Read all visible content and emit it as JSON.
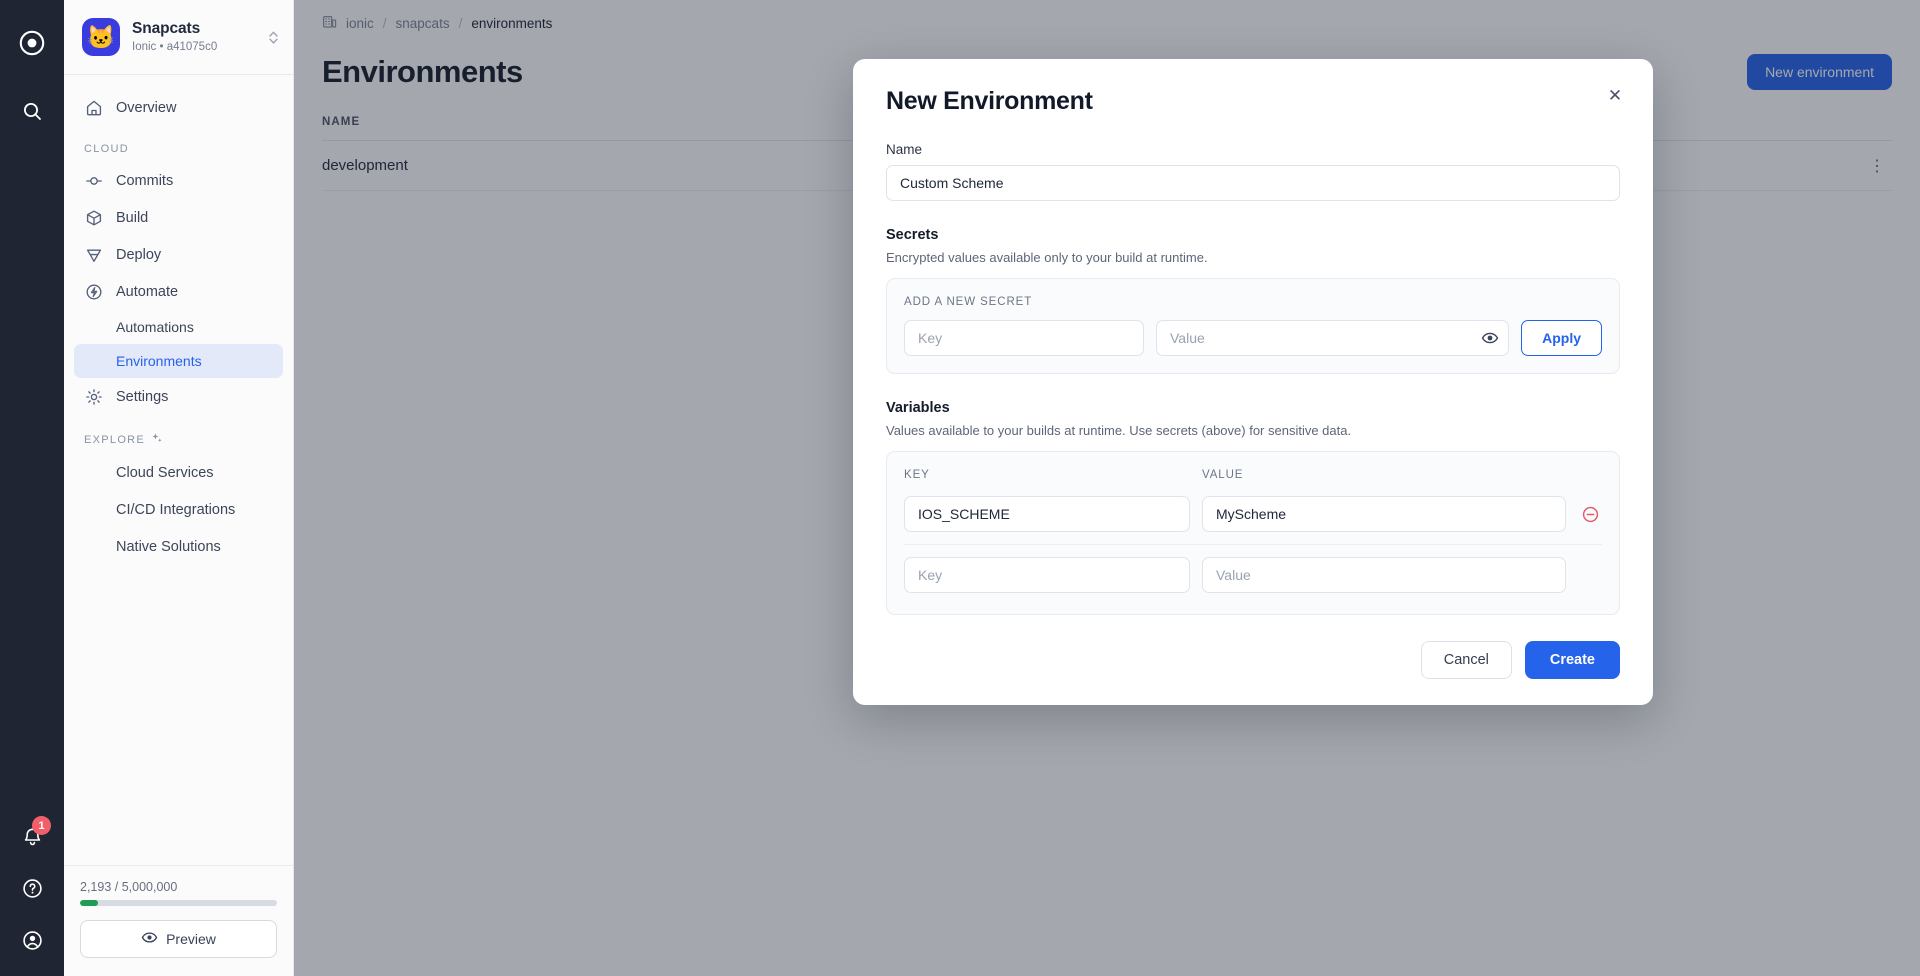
{
  "rail": {
    "logo_icon": "ionic-logo-icon",
    "search_icon": "search-icon",
    "bell_icon": "bell-icon",
    "bell_badge": "1",
    "help_icon": "help-circle-icon",
    "account_icon": "account-circle-icon"
  },
  "sidebar": {
    "project": {
      "avatar_icon": "cat-avatar-icon",
      "name": "Snapcats",
      "subtitle": "Ionic • a41075c0",
      "switcher_icon": "chevron-updown-icon"
    },
    "top_items": [
      {
        "label": "Overview",
        "icon": "home-icon"
      }
    ],
    "cloud_group": "CLOUD",
    "cloud_items": [
      {
        "label": "Commits",
        "icon": "commit-icon"
      },
      {
        "label": "Build",
        "icon": "cube-icon"
      },
      {
        "label": "Deploy",
        "icon": "deploy-icon"
      },
      {
        "label": "Automate",
        "icon": "automate-icon"
      }
    ],
    "automate_children": [
      {
        "label": "Automations",
        "active": false
      },
      {
        "label": "Environments",
        "active": true
      }
    ],
    "settings_item": {
      "label": "Settings",
      "icon": "gear-icon"
    },
    "explore_group": "EXPLORE",
    "explore_group_icon": "sparkles-icon",
    "explore_items": [
      {
        "label": "Cloud Services"
      },
      {
        "label": "CI/CD Integrations"
      },
      {
        "label": "Native Solutions"
      }
    ],
    "usage": {
      "text": "2,193 / 5,000,000",
      "percent": 9,
      "bar_color": "#1f9d55"
    },
    "preview_button": {
      "label": "Preview",
      "icon": "eye-icon"
    }
  },
  "main": {
    "breadcrumb": {
      "icon": "building-icon",
      "items": [
        "ionic",
        "snapcats",
        "environments"
      ],
      "separator": "/"
    },
    "page_title": "Environments",
    "new_environment_button": "New environment",
    "table": {
      "columns": [
        "NAME"
      ],
      "rows": [
        {
          "name": "development",
          "menu_icon": "kebab-menu-icon"
        }
      ]
    }
  },
  "modal": {
    "title": "New Environment",
    "close_icon": "close-icon",
    "name_label": "Name",
    "name_value": "Custom Scheme",
    "name_placeholder": "Name",
    "secrets": {
      "title": "Secrets",
      "description": "Encrypted values available only to your build at runtime.",
      "panel_label": "ADD A NEW SECRET",
      "key_placeholder": "Key",
      "key_value": "",
      "value_placeholder": "Value",
      "value_value": "",
      "reveal_icon": "eye-icon",
      "apply_button": "Apply"
    },
    "variables": {
      "title": "Variables",
      "description": "Values available to your builds at runtime. Use secrets (above) for sensitive data.",
      "col_key": "KEY",
      "col_value": "VALUE",
      "rows": [
        {
          "key": "IOS_SCHEME",
          "value": "MyScheme",
          "key_placeholder": "Key",
          "value_placeholder": "Value",
          "delete_icon": "remove-circle-icon"
        },
        {
          "key": "",
          "value": "",
          "key_placeholder": "Key",
          "value_placeholder": "Value"
        }
      ]
    },
    "cancel_button": "Cancel",
    "create_button": "Create"
  },
  "colors": {
    "accent": "#2563eb",
    "danger": "#e4566a",
    "rail_bg": "#1f2533",
    "badge": "#f1606a",
    "usage_green": "#1f9d55"
  }
}
